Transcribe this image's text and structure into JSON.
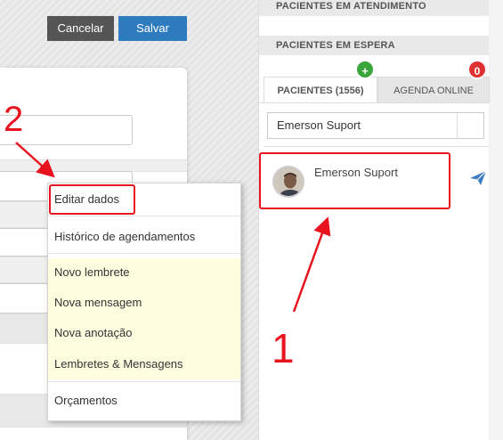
{
  "toolbar": {
    "cancel_label": "Cancelar",
    "save_label": "Salvar"
  },
  "context_menu": {
    "items": [
      {
        "label": "Editar dados"
      },
      {
        "label": "Histórico de agendamentos"
      },
      {
        "label": "Novo lembrete"
      },
      {
        "label": "Nova mensagem"
      },
      {
        "label": "Nova anotação"
      },
      {
        "label": "Lembretes & Mensagens"
      },
      {
        "label": "Orçamentos"
      }
    ]
  },
  "right_panel": {
    "section_attending": "PACIENTES EM ATENDIMENTO",
    "section_waiting": "PACIENTES EM ESPERA",
    "tabs": [
      {
        "label": "PACIENTES (1556)",
        "badge": "+",
        "badge_color": "#3aa53a"
      },
      {
        "label": "AGENDA ONLINE",
        "badge": "0",
        "badge_color": "#e03131"
      }
    ],
    "search_value": "Emerson Suport",
    "patients": [
      {
        "name": "Emerson Suport",
        "icon": "send-icon"
      }
    ]
  },
  "annotations": {
    "step_1": "1",
    "step_2": "2",
    "color": "#e8131e"
  }
}
